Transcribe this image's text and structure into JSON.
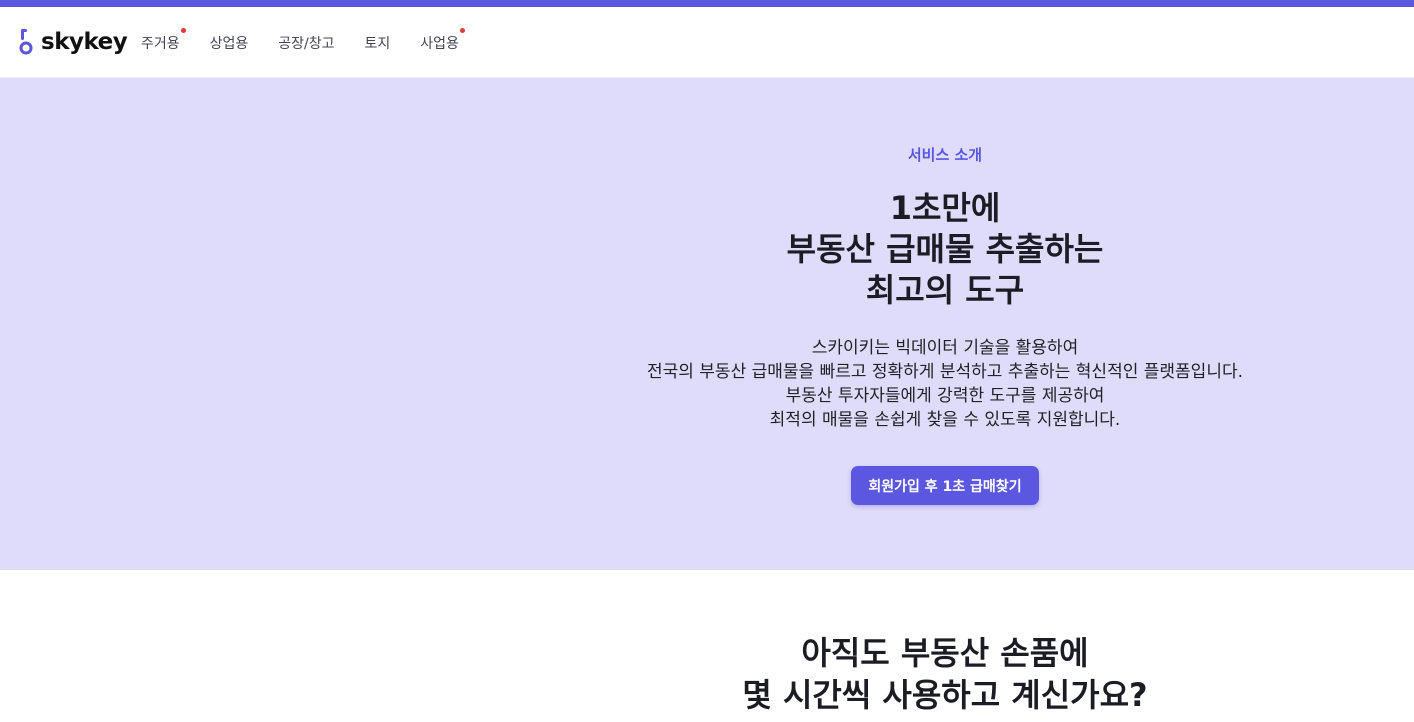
{
  "brand": {
    "name": "skykey"
  },
  "nav": {
    "items": [
      {
        "label": "주거용",
        "has_dot": true
      },
      {
        "label": "상업용",
        "has_dot": false
      },
      {
        "label": "공장/창고",
        "has_dot": false
      },
      {
        "label": "토지",
        "has_dot": false
      },
      {
        "label": "사업용",
        "has_dot": true
      }
    ]
  },
  "hero": {
    "eyebrow": "서비스 소개",
    "title_lines": [
      "1초만에",
      "부동산 급매물 추출하는",
      "최고의 도구"
    ],
    "description_lines": [
      "스카이키는 빅데이터 기술을 활용하여",
      "전국의 부동산 급매물을 빠르고 정확하게 분석하고 추출하는 혁신적인 플랫폼입니다.",
      "부동산 투자자들에게 강력한 도구를 제공하여",
      "최적의 매물을 손쉽게 찾을 수 있도록 지원합니다."
    ],
    "cta_label": "회원가입 후 1초 급매찾기"
  },
  "section2": {
    "title_lines": [
      "아직도 부동산 손품에",
      "몇 시간씩 사용하고 계신가요?"
    ]
  },
  "colors": {
    "accent": "#5b57e0",
    "hero_bg": "#dedcfa",
    "notification_dot": "#e53935"
  }
}
